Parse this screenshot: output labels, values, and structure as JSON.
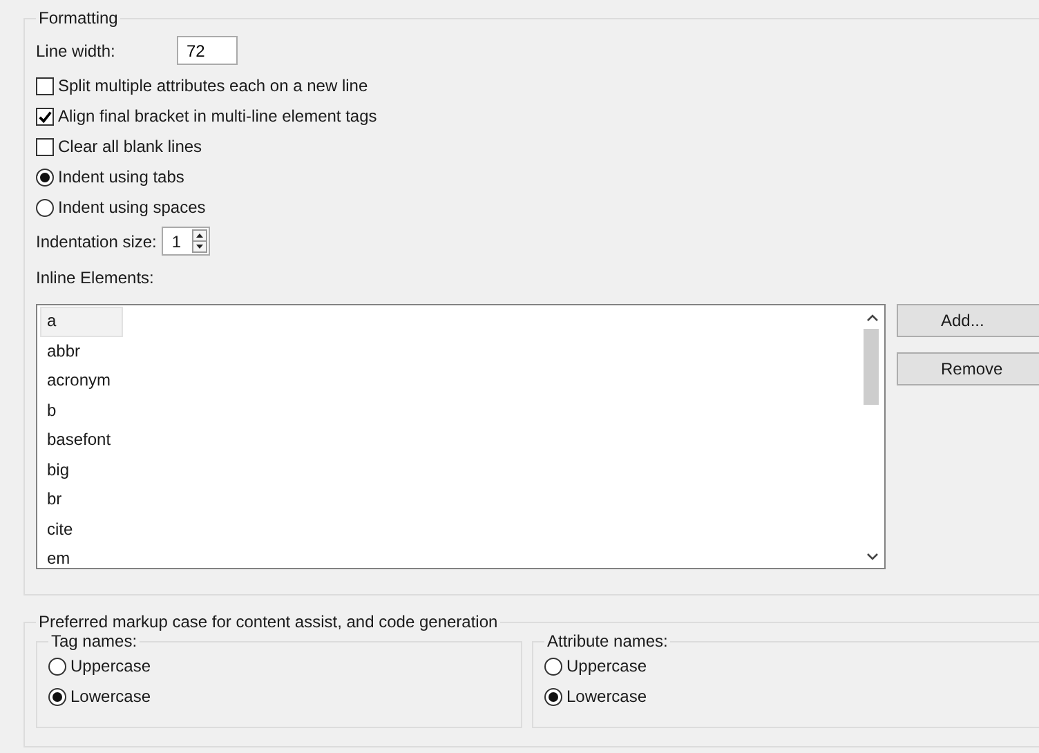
{
  "formatting": {
    "title": "Formatting",
    "line_width": {
      "label": "Line width:",
      "value": "72"
    },
    "options": [
      {
        "kind": "checkbox",
        "label": "Split multiple attributes each on a new line",
        "checked": false
      },
      {
        "kind": "checkbox",
        "label": "Align final bracket in multi-line element tags",
        "checked": true
      },
      {
        "kind": "checkbox",
        "label": "Clear all blank lines",
        "checked": false
      },
      {
        "kind": "radio",
        "label": "Indent using tabs",
        "selected": true
      },
      {
        "kind": "radio",
        "label": "Indent using spaces",
        "selected": false
      }
    ],
    "indentation_size": {
      "label": "Indentation size:",
      "value": "1"
    },
    "inline_elements": {
      "label": "Inline Elements:",
      "items": [
        {
          "text": "a",
          "selected": true
        },
        {
          "text": "abbr",
          "selected": false
        },
        {
          "text": "acronym",
          "selected": false
        },
        {
          "text": "b",
          "selected": false
        },
        {
          "text": "basefont",
          "selected": false
        },
        {
          "text": "big",
          "selected": false
        },
        {
          "text": "br",
          "selected": false
        },
        {
          "text": "cite",
          "selected": false
        },
        {
          "text": "em",
          "selected": false
        }
      ]
    },
    "buttons": [
      "Add...",
      "Remove"
    ]
  },
  "markup_case": {
    "title": "Preferred markup case for content assist, and code generation",
    "groups": [
      {
        "title": "Tag names:",
        "options": [
          {
            "label": "Uppercase",
            "selected": false
          },
          {
            "label": "Lowercase",
            "selected": true
          }
        ]
      },
      {
        "title": "Attribute names:",
        "options": [
          {
            "label": "Uppercase",
            "selected": false
          },
          {
            "label": "Lowercase",
            "selected": true
          }
        ]
      }
    ]
  }
}
